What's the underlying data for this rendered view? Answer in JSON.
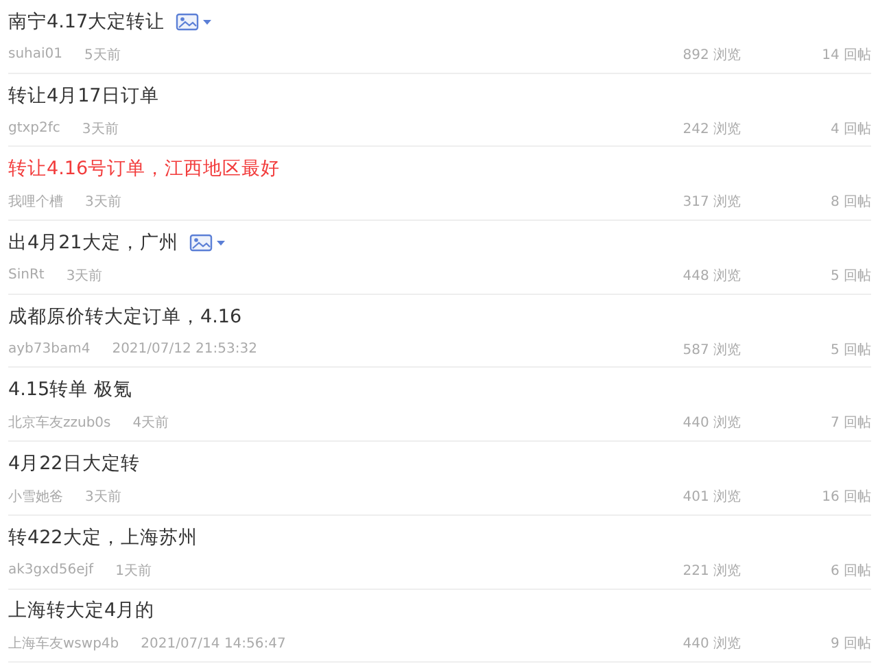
{
  "posts": [
    {
      "title": "南宁4.17大定转让",
      "highlighted": false,
      "has_image": true,
      "author": "suhai01",
      "time": "5天前",
      "views": "892 浏览",
      "replies": "14 回帖"
    },
    {
      "title": "转让4月17日订单",
      "highlighted": false,
      "has_image": false,
      "author": "gtxp2fc",
      "time": "3天前",
      "views": "242 浏览",
      "replies": "4 回帖"
    },
    {
      "title": "转让4.16号订单，江西地区最好",
      "highlighted": true,
      "has_image": false,
      "author": "我哩个槽",
      "time": "3天前",
      "views": "317 浏览",
      "replies": "8 回帖"
    },
    {
      "title": "出4月21大定，广州",
      "highlighted": false,
      "has_image": true,
      "author": "SinRt",
      "time": "3天前",
      "views": "448 浏览",
      "replies": "5 回帖"
    },
    {
      "title": "成都原价转大定订单，4.16",
      "highlighted": false,
      "has_image": false,
      "author": "ayb73bam4",
      "time": "2021/07/12 21:53:32",
      "views": "587 浏览",
      "replies": "5 回帖"
    },
    {
      "title": "4.15转单 极氪",
      "highlighted": false,
      "has_image": false,
      "author": "北京车友zzub0s",
      "time": "4天前",
      "views": "440 浏览",
      "replies": "7 回帖"
    },
    {
      "title": "4月22日大定转",
      "highlighted": false,
      "has_image": false,
      "author": "小雪她爸",
      "time": "3天前",
      "views": "401 浏览",
      "replies": "16 回帖"
    },
    {
      "title": "转422大定，上海苏州",
      "highlighted": false,
      "has_image": false,
      "author": "ak3gxd56ejf",
      "time": "1天前",
      "views": "221 浏览",
      "replies": "6 回帖"
    },
    {
      "title": "上海转大定4月的",
      "highlighted": false,
      "has_image": false,
      "author": "上海车友wswp4b",
      "time": "2021/07/14 14:56:47",
      "views": "440 浏览",
      "replies": "9 回帖"
    }
  ]
}
